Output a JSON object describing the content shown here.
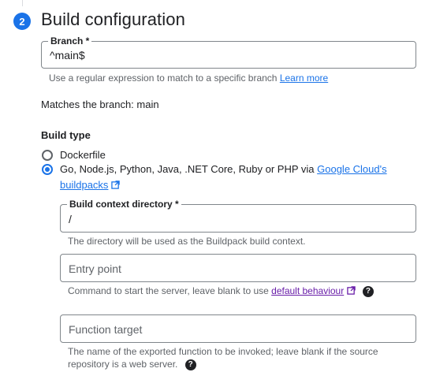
{
  "step": {
    "number": "2",
    "title": "Build configuration"
  },
  "branch": {
    "label": "Branch *",
    "value": "^main$",
    "hint_text": "Use a regular expression to match to a specific branch",
    "hint_link": "Learn more",
    "matches_text": "Matches the branch: main"
  },
  "build_type": {
    "label": "Build type",
    "options": [
      {
        "label": "Dockerfile",
        "selected": false
      },
      {
        "label": "Go, Node.js, Python, Java, .NET Core, Ruby or PHP via",
        "link_part1": "Google Cloud's",
        "link_part2": "buildpacks",
        "selected": true
      }
    ]
  },
  "build_context": {
    "label": "Build context directory *",
    "value": "/",
    "hint": "The directory will be used as the Buildpack build context."
  },
  "entry_point": {
    "placeholder": "Entry point",
    "hint_text": "Command to start the server, leave blank to use",
    "hint_link": "default behaviour"
  },
  "function_target": {
    "placeholder": "Function target",
    "hint_line1": "The name of the exported function to be invoked; leave blank if the source",
    "hint_line2": "repository is a web server."
  },
  "icons": {
    "external": "external-link-icon",
    "help": "help-circle-icon",
    "help_glyph": "?"
  },
  "colors": {
    "accent": "#1a73e8",
    "visited_link": "#681da8",
    "text": "#202124",
    "muted": "#5f6368"
  }
}
